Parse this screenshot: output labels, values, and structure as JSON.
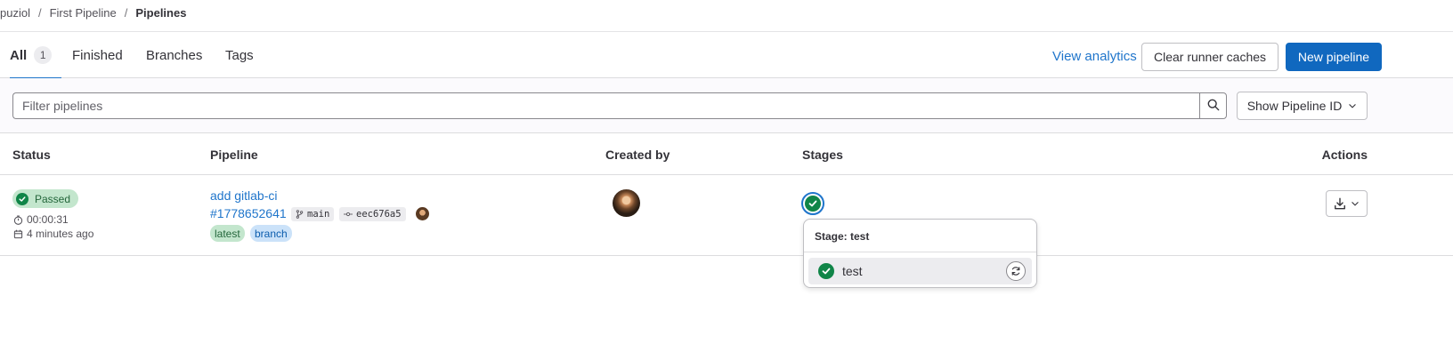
{
  "breadcrumb": {
    "items": [
      "puziol",
      "First Pipeline",
      "Pipelines"
    ],
    "separator": "/"
  },
  "tabs": {
    "all_label": "All",
    "all_count": "1",
    "finished_label": "Finished",
    "branches_label": "Branches",
    "tags_label": "Tags"
  },
  "header_actions": {
    "analytics_label": "View analytics",
    "clear_caches_label": "Clear runner caches",
    "new_pipeline_label": "New pipeline"
  },
  "filter": {
    "placeholder": "Filter pipelines",
    "value": "",
    "id_select_label": "Show Pipeline ID"
  },
  "table": {
    "columns": [
      "Status",
      "Pipeline",
      "Created by",
      "Stages",
      "Actions"
    ],
    "rows": [
      {
        "status": "Passed",
        "duration": "00:00:31",
        "finished": "4 minutes ago",
        "commit_title": "add gitlab-ci",
        "pipeline_id": "#1778652641",
        "ref": "main",
        "sha": "eec676a5",
        "tags": [
          "latest",
          "branch"
        ],
        "stage_name": "test"
      }
    ]
  },
  "stage_popover": {
    "title": "Stage: test",
    "jobs": [
      {
        "name": "test",
        "status": "passed"
      }
    ]
  },
  "colors": {
    "link_blue": "#1f75cb",
    "primary_button": "#1068bf",
    "success_green": "#108548",
    "success_badge_bg": "#c3e6cd",
    "branch_badge_bg": "#cbe2f9"
  },
  "icons": {
    "search": "search-icon",
    "chevron": "chevron-down-icon",
    "clock": "clock-icon",
    "calendar": "calendar-icon",
    "branch": "branch-icon",
    "commit": "commit-icon",
    "status_success": "status-success-icon",
    "download": "download-icon",
    "retry": "retry-icon"
  }
}
